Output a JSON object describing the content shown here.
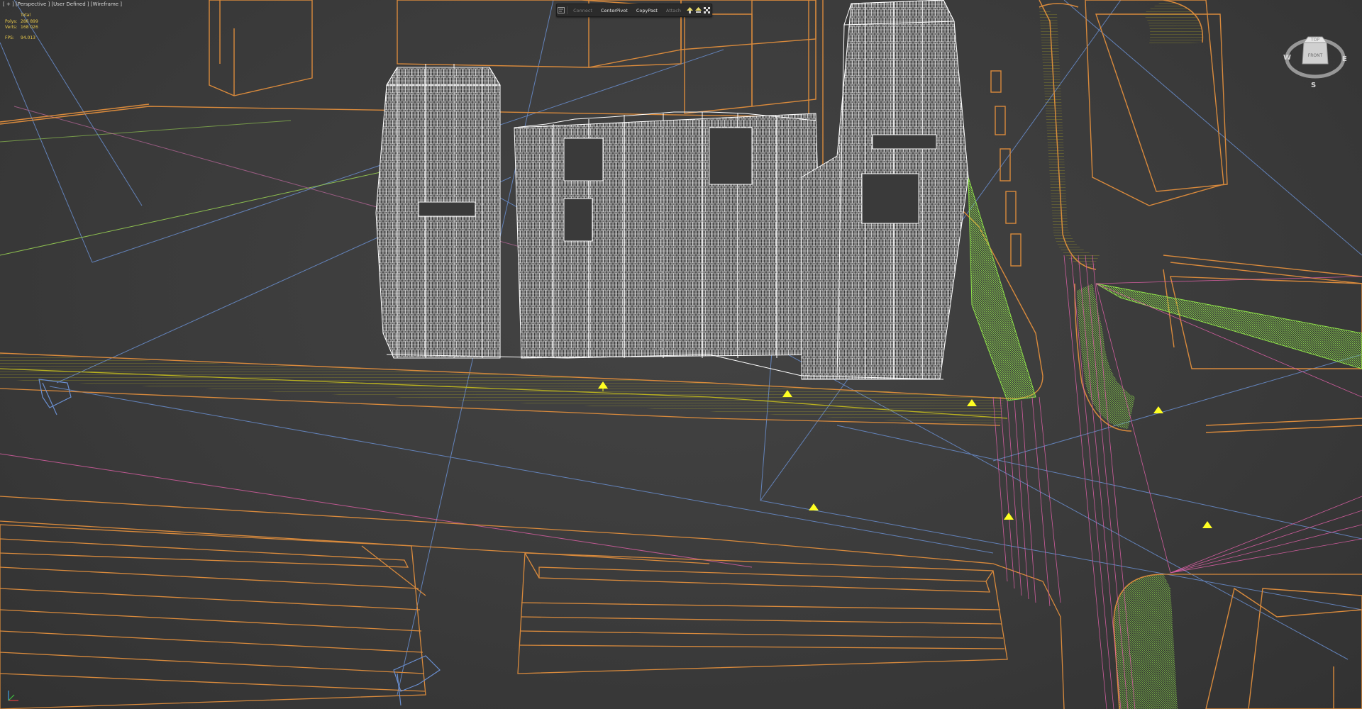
{
  "viewport": {
    "label": "[ + ] [Perspective ] [User Defined ] [Wireframe ]"
  },
  "stats": {
    "header": "Total",
    "polys_label": "Polys:",
    "polys_value": "286 899",
    "verts_label": "Verts:",
    "verts_value": "168 026",
    "fps_label": "FPS:",
    "fps_value": "94.013"
  },
  "toolbar": {
    "connect_label": "Connect",
    "centerpivot_label": "CenterPivot",
    "copypast_label": "CopyPast",
    "attach_label": "Attach"
  },
  "viewcube": {
    "top_label": "TOP",
    "front_label": "FRONT",
    "west": "W",
    "east": "E",
    "south": "S"
  },
  "colors": {
    "background": "#3a3a3a",
    "building": "#ffffff",
    "context": "#d98a3c",
    "road": "#b8b020",
    "camera_line": "#6a8fd0",
    "light_green": "#8ee04a",
    "light_pink": "#e060a8",
    "light_marker": "#ffff22"
  }
}
